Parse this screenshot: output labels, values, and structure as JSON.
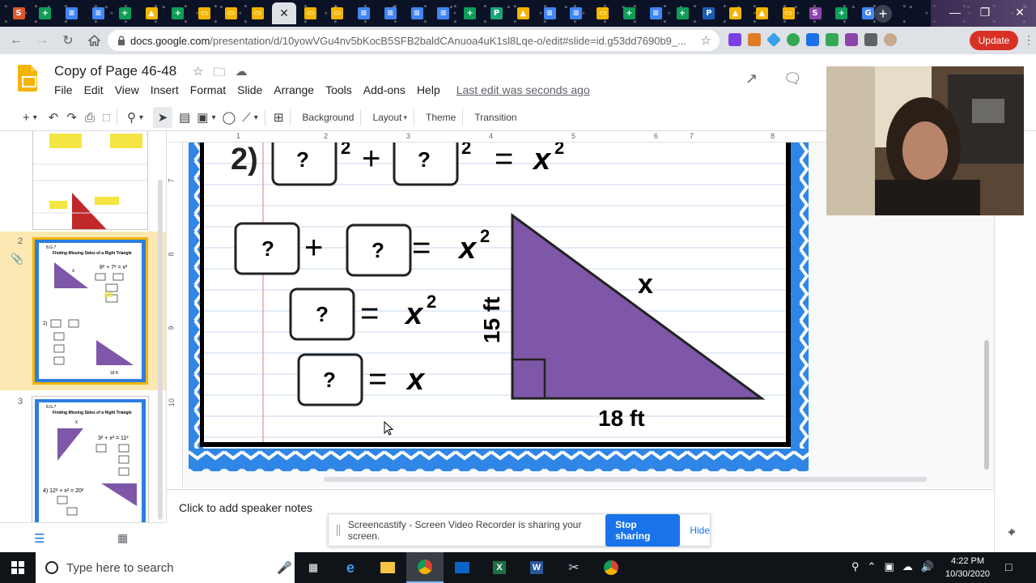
{
  "browser": {
    "url_host": "docs.google.com",
    "url_path": "/presentation/d/10yowVGu4nv5bKocB5SFB2baldCAnuoa4uK1sl8Lqe-o/edit#slide=id.g53dd7690b9_...",
    "update_label": "Update",
    "tabs": [
      {
        "icon": "screencastify-icon",
        "color": "#e0572a"
      },
      {
        "icon": "sheets-icon",
        "color": "#0f9d58"
      },
      {
        "icon": "docs-icon",
        "color": "#4285f4"
      },
      {
        "icon": "docs-icon",
        "color": "#4285f4"
      },
      {
        "icon": "sheets-icon",
        "color": "#0f9d58"
      },
      {
        "icon": "drive-icon",
        "color": "#f4b400"
      },
      {
        "icon": "sheets-icon",
        "color": "#0f9d58"
      },
      {
        "icon": "slides-icon",
        "color": "#f4b400"
      },
      {
        "icon": "slides-icon",
        "color": "#f4b400"
      },
      {
        "icon": "slides-icon",
        "color": "#f4b400"
      },
      {
        "icon": "close-icon",
        "color": "#dee1e6",
        "active": true
      },
      {
        "icon": "slides-icon",
        "color": "#f4b400"
      },
      {
        "icon": "slides-icon",
        "color": "#f4b400"
      },
      {
        "icon": "docs-icon",
        "color": "#4285f4"
      },
      {
        "icon": "docs-icon",
        "color": "#4285f4"
      },
      {
        "icon": "docs-icon",
        "color": "#4285f4"
      },
      {
        "icon": "docs-icon",
        "color": "#4285f4"
      },
      {
        "icon": "sheets-icon",
        "color": "#0f9d58"
      },
      {
        "icon": "pear-deck-icon",
        "color": "#1aa37a"
      },
      {
        "icon": "drive-icon",
        "color": "#f4b400"
      },
      {
        "icon": "docs-icon",
        "color": "#4285f4"
      },
      {
        "icon": "docs-icon",
        "color": "#4285f4"
      },
      {
        "icon": "slides-icon",
        "color": "#f4b400"
      },
      {
        "icon": "sheets-icon",
        "color": "#0f9d58"
      },
      {
        "icon": "docs-icon",
        "color": "#4285f4"
      },
      {
        "icon": "sheets-icon",
        "color": "#0f9d58"
      },
      {
        "icon": "pear-deck-icon",
        "color": "#1a5fb4"
      },
      {
        "icon": "drive-icon",
        "color": "#f4b400"
      },
      {
        "icon": "drive-icon",
        "color": "#f4b400"
      },
      {
        "icon": "slides-icon",
        "color": "#f4b400"
      },
      {
        "icon": "script-icon",
        "color": "#8e44ad"
      },
      {
        "icon": "sheets-icon",
        "color": "#0f9d58"
      },
      {
        "icon": "google-icon",
        "color": "#4285f4"
      }
    ]
  },
  "app": {
    "title": "Copy of Page 46-48",
    "menu": [
      "File",
      "Edit",
      "View",
      "Insert",
      "Format",
      "Slide",
      "Arrange",
      "Tools",
      "Add-ons",
      "Help"
    ],
    "last_edit": "Last edit was seconds ago",
    "toolbar_text": {
      "background": "Background",
      "layout": "Layout",
      "theme": "Theme",
      "transition": "Transition"
    },
    "ruler_top": [
      "1",
      "2",
      "3",
      "4",
      "5",
      "6",
      "7",
      "8"
    ],
    "ruler_left": [
      "7",
      "8",
      "9",
      "10"
    ]
  },
  "filmstrip": {
    "items": [
      {
        "num": "2",
        "code": "8.G.7",
        "title": "Finding Missing Sides of a Right Triangle"
      },
      {
        "num": "3",
        "code": "8.G.7",
        "title": "Finding Missing Sides of a Right Triangle"
      }
    ]
  },
  "slide": {
    "problem_label": "2)",
    "q_mark": "?",
    "plus": "+",
    "equals": "=",
    "var_x": "x",
    "exp2": "2",
    "side_vertical": "15 ft",
    "side_horizontal": "18 ft",
    "hypotenuse": "x"
  },
  "notes": {
    "placeholder": "Click to add speaker notes"
  },
  "share": {
    "message": "Screencastify - Screen Video Recorder is sharing your screen.",
    "stop": "Stop sharing",
    "hide": "Hide"
  },
  "taskbar": {
    "search_placeholder": "Type here to search",
    "time": "4:22 PM",
    "date": "10/30/2020"
  }
}
